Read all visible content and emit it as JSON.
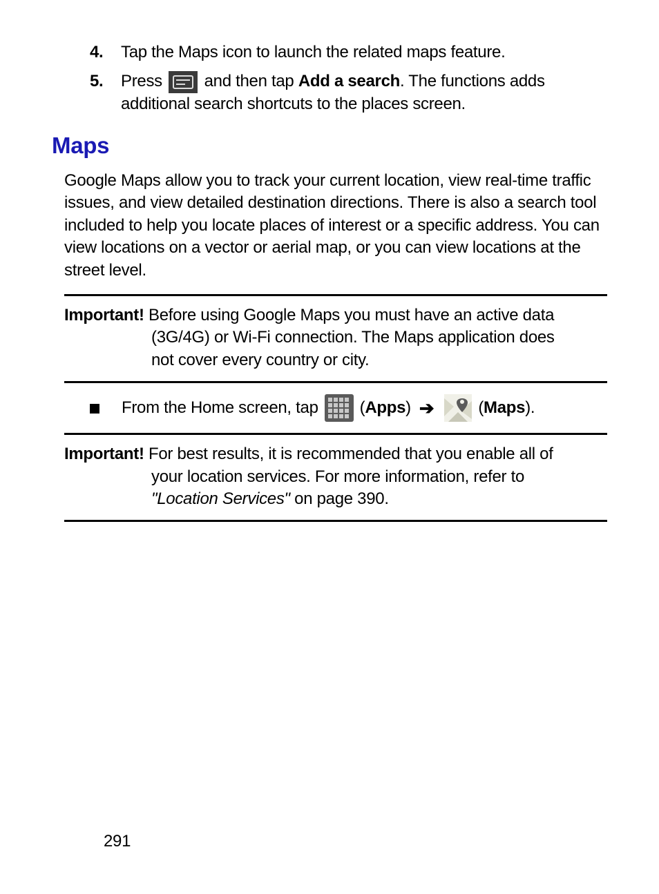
{
  "steps": {
    "item4": {
      "num": "4.",
      "text": "Tap the Maps icon to launch the related maps feature."
    },
    "item5": {
      "num": "5.",
      "press": "Press",
      "then": "and then tap",
      "add_search": "Add a search",
      "rest": ". The functions adds additional search shortcuts to the places screen."
    }
  },
  "section": {
    "title": "Maps"
  },
  "intro": "Google Maps allow you to track your current location, view real-time traffic issues, and view detailed destination directions. There is also a search tool included to help you locate places of interest or a specific address. You can view locations on a vector or aerial map, or you can view locations at the street level.",
  "note1": {
    "label": "Important!",
    "l1": " Before using Google Maps you must have an active data",
    "l2": "(3G/4G) or Wi-Fi connection. The Maps application does",
    "l3": "not cover every country or city."
  },
  "nav": {
    "from": "From the Home screen, tap",
    "apps": "Apps",
    "maps": "Maps"
  },
  "note2": {
    "label": "Important!",
    "l1": " For best results, it is recommended that you enable all of",
    "l2": "your location services. For more information, refer to",
    "ref_italic": "\"Location Services\"",
    "ref_rest": " on page 390."
  },
  "page": "291"
}
